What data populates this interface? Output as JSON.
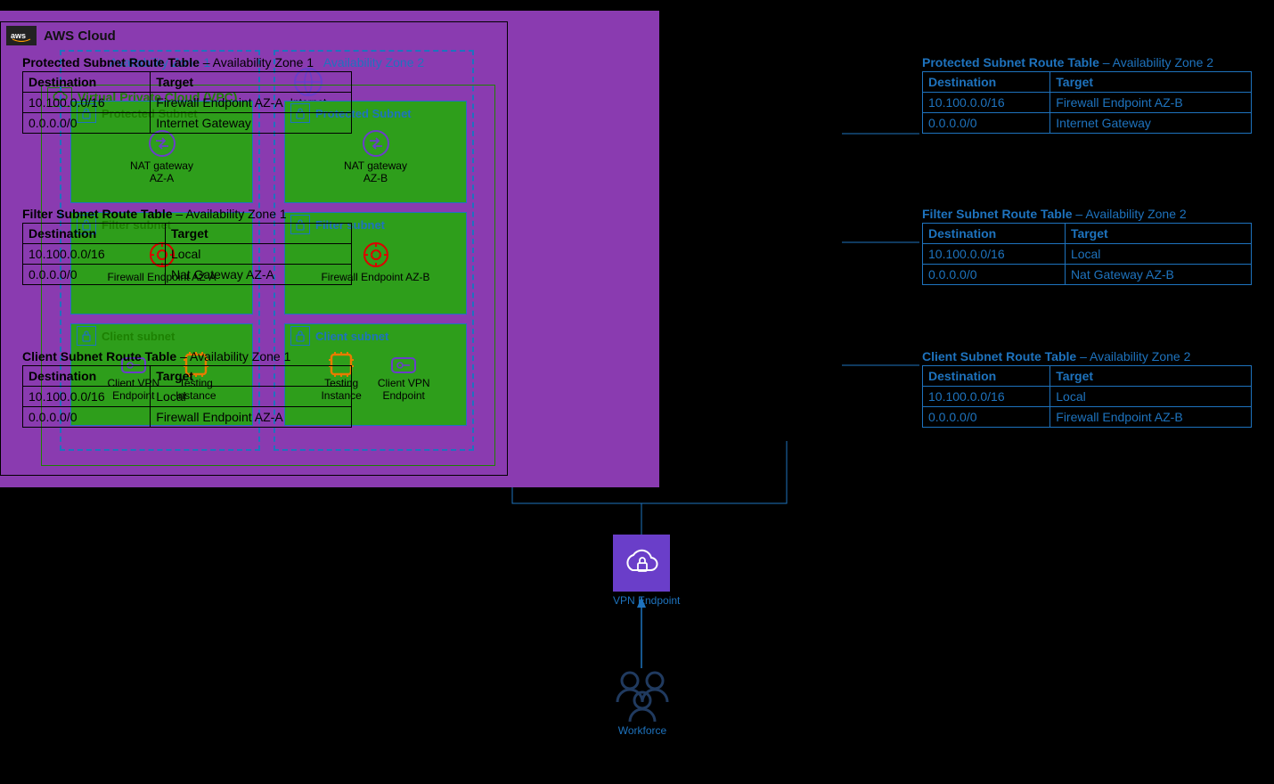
{
  "aws_cloud_title": "AWS Cloud",
  "internet_label": "Internet Gateway",
  "internet_short": "Internet",
  "vpc_title": "Virtual Private Cloud (VPC)",
  "az1": {
    "title": "Availability Zone 1",
    "protected": {
      "title": "Protected Subnet",
      "resource": "NAT gateway\nAZ-A"
    },
    "filter": {
      "title": "Filter subnet",
      "resource": "Firewall Endpoint AZ-A"
    },
    "client": {
      "title": "Client subnet",
      "left": "Client VPN\nEndpoint",
      "right": "Testing\nInstance"
    }
  },
  "az2": {
    "title": "Availability Zone 2",
    "protected": {
      "title": "Protected Subnet",
      "resource": "NAT gateway\nAZ-B"
    },
    "filter": {
      "title": "Filter subnet",
      "resource": "Firewall Endpoint AZ-B"
    },
    "client": {
      "title": "Client subnet",
      "left": "Testing\nInstance",
      "right": "Client VPN\nEndpoint"
    }
  },
  "tables_az1": {
    "protected": {
      "title_bold": "Protected Subnet Route Table",
      "title_rest": " – Availability Zone 1",
      "headers": [
        "Destination",
        "Target"
      ],
      "rows": [
        [
          "10.100.0.0/16",
          "Firewall Endpoint AZ-A"
        ],
        [
          "0.0.0.0/0",
          "Internet Gateway"
        ]
      ]
    },
    "filter": {
      "title_bold": "Filter Subnet Route Table",
      "title_rest": " – Availability Zone 1",
      "headers": [
        "Destination",
        "Target"
      ],
      "rows": [
        [
          "10.100.0.0/16",
          "Local"
        ],
        [
          "0.0.0.0/0",
          "Nat Gateway AZ-A"
        ]
      ]
    },
    "client": {
      "title_bold": "Client Subnet Route Table",
      "title_rest": " – Availability Zone 1",
      "headers": [
        "Destination",
        "Target"
      ],
      "rows": [
        [
          "10.100.0.0/16",
          "Local"
        ],
        [
          "0.0.0.0/0",
          "Firewall Endpoint AZ-A"
        ]
      ]
    }
  },
  "tables_az2": {
    "protected": {
      "title_bold": "Protected Subnet Route Table",
      "title_rest": " – Availability Zone 2",
      "headers": [
        "Destination",
        "Target"
      ],
      "rows": [
        [
          "10.100.0.0/16",
          "Firewall Endpoint AZ-B"
        ],
        [
          "0.0.0.0/0",
          "Internet Gateway"
        ]
      ]
    },
    "filter": {
      "title_bold": "Filter Subnet Route Table",
      "title_rest": " – Availability Zone 2",
      "headers": [
        "Destination",
        "Target"
      ],
      "rows": [
        [
          "10.100.0.0/16",
          "Local"
        ],
        [
          "0.0.0.0/0",
          "Nat Gateway AZ-B"
        ]
      ]
    },
    "client": {
      "title_bold": "Client Subnet Route Table",
      "title_rest": " – Availability Zone 2",
      "headers": [
        "Destination",
        "Target"
      ],
      "rows": [
        [
          "10.100.0.0/16",
          "Local"
        ],
        [
          "0.0.0.0/0",
          "Firewall Endpoint AZ-B"
        ]
      ]
    }
  },
  "vpn_label": "VPN Endpoint",
  "workforce_label": "Workforce"
}
